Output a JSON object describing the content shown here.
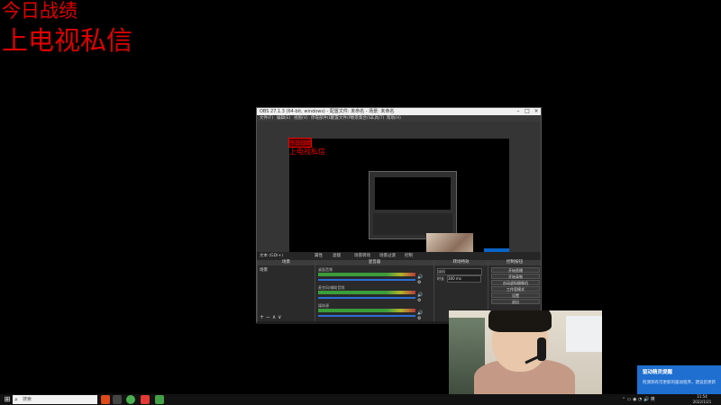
{
  "overlay": {
    "title": "今日战绩",
    "subtitle": "上电视私信"
  },
  "obs": {
    "window_title": "OBS 27.1.3 (64-bit, windows) - 配置文件: 未命名 - 场景: 未命名",
    "menu": [
      "文件(F)",
      "编辑(E)",
      "视图(V)",
      "停靠部件(D)",
      "配置文件(P)",
      "场景集合(S)",
      "工具(T)",
      "帮助(H)"
    ],
    "preview_text1": "今日战绩",
    "preview_text2": "上电视私信",
    "scene_toolbar": {
      "source_label": "文本 (GDI+)",
      "properties": "属性",
      "filters": "滤镜",
      "tabs": [
        "场景转场",
        "场景过渡",
        "控制"
      ]
    },
    "panels": {
      "scenes_header": "场景",
      "scene_item": "场景",
      "mixer_header": "混音器",
      "transitions_header": "转场特效",
      "controls_header": "控制按钮"
    },
    "mixer": [
      {
        "name": "桌面音频",
        "level": 0.0
      },
      {
        "name": "麦克风/辅助音频",
        "level": 0.0
      },
      {
        "name": "媒体源",
        "level": 0.0
      }
    ],
    "transitions": {
      "type": "淡出",
      "duration_label": "时长",
      "duration": "300 ms"
    },
    "controls": [
      "开始直播",
      "开始录制",
      "启动虚拟摄像机",
      "工作室模式",
      "设置",
      "退出"
    ],
    "scene_buttons": "+ − ∧ ∨"
  },
  "notification": {
    "title": "驱动精灵提醒",
    "body": "检测到有可更新的驱动程序，建议您更新"
  },
  "taskbar": {
    "search_placeholder": "搜索",
    "time": "11:54",
    "date": "2022/1/21"
  },
  "colors": {
    "overlay_red": "#e00000",
    "notification_blue": "#1f6fd0",
    "volume_blue": "#2d6ed6"
  }
}
